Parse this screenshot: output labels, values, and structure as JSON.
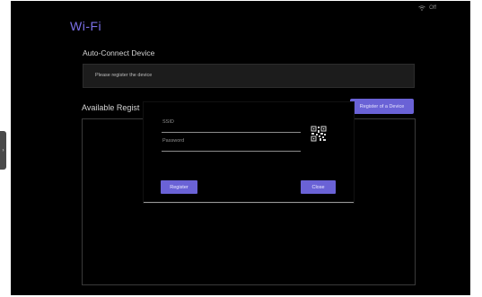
{
  "status_bar": {
    "wifi_text": "Off",
    "wifi_icon": "wifi-icon"
  },
  "page": {
    "title": "Wi-Fi"
  },
  "auto_connect": {
    "title": "Auto-Connect Device",
    "message": "Please register the device"
  },
  "available": {
    "title": "Available Regist",
    "register_button": "Register of a Device"
  },
  "side_tab": {
    "icon": "chevron-right-icon",
    "glyph": "›"
  },
  "dialog": {
    "ssid_placeholder": "SSID",
    "password_placeholder": "Password",
    "qr_icon": "qr-code-icon",
    "register_label": "Register",
    "close_label": "Close"
  },
  "colors": {
    "accent": "#6a62d6",
    "title": "#7b70e8",
    "background": "#000000"
  }
}
